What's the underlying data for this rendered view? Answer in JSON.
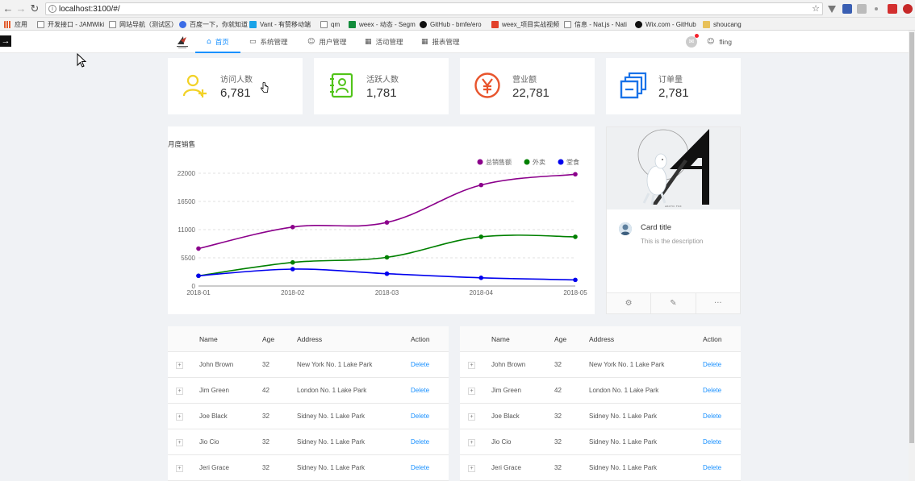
{
  "browser": {
    "url": "localhost:3100/#/",
    "bookmarks": [
      "应用",
      "开发接口 - JAMWiki",
      "网站导航（测试区）",
      "百度一下，你就知道",
      "Vant - 有赞移动端",
      "qm",
      "weex - 动态 - Segm",
      "GitHub - bmfe/ero",
      "weex_项目实战视频",
      "信息 - Nat.js - Nati",
      "Wix.com - GitHub",
      "shoucang"
    ]
  },
  "header": {
    "menu": [
      {
        "label": "首页",
        "icon": "home-icon",
        "active": true
      },
      {
        "label": "系统管理",
        "icon": "desktop-icon",
        "active": false
      },
      {
        "label": "用户管理",
        "icon": "user-icon",
        "active": false
      },
      {
        "label": "活动管理",
        "icon": "calendar-icon",
        "active": false
      },
      {
        "label": "报表管理",
        "icon": "table-icon",
        "active": false
      }
    ],
    "username": "fling"
  },
  "stats": [
    {
      "label": "访问人数",
      "value": "6,781",
      "icon": "user-add-icon",
      "color": "#f2d227"
    },
    {
      "label": "活跃人数",
      "value": "1,781",
      "icon": "contacts-icon",
      "color": "#52c41a"
    },
    {
      "label": "营业额",
      "value": "22,781",
      "icon": "yen-circle-icon",
      "color": "#e8542c"
    },
    {
      "label": "订单量",
      "value": "2,781",
      "icon": "orders-stack-icon",
      "color": "#1a73e8"
    }
  ],
  "chart_data": {
    "type": "line",
    "title": "月度销售",
    "categories": [
      "2018-01",
      "2018-02",
      "2018-03",
      "2018-04",
      "2018-05"
    ],
    "y_ticks": [
      "0",
      "5500",
      "11000",
      "16500",
      "22000"
    ],
    "ylim": [
      0,
      22000
    ],
    "legend_position": "top-right",
    "grid": true,
    "series": [
      {
        "name": "总销售额",
        "color": "#8b008b",
        "values": [
          7300,
          11500,
          12400,
          19700,
          21800
        ]
      },
      {
        "name": "外卖",
        "color": "#008000",
        "values": [
          2000,
          4600,
          5600,
          9600,
          9600
        ]
      },
      {
        "name": "堂食",
        "color": "#0000ee",
        "values": [
          2000,
          3300,
          2400,
          1600,
          1200
        ]
      }
    ]
  },
  "profile_card": {
    "title": "Card title",
    "description": "This is the description",
    "actions": [
      "setting-icon",
      "edit-icon",
      "ellipsis-icon"
    ],
    "cover_caption": "ARCTIC FOX"
  },
  "tables": [
    {
      "columns": [
        "Name",
        "Age",
        "Address",
        "Action"
      ],
      "rows": [
        {
          "name": "John Brown",
          "age": "32",
          "address": "New York No. 1 Lake Park",
          "action": "Delete"
        },
        {
          "name": "Jim Green",
          "age": "42",
          "address": "London No. 1 Lake Park",
          "action": "Delete"
        },
        {
          "name": "Joe Black",
          "age": "32",
          "address": "Sidney No. 1 Lake Park",
          "action": "Delete"
        },
        {
          "name": "Jio Cio",
          "age": "32",
          "address": "Sidney No. 1 Lake Park",
          "action": "Delete"
        },
        {
          "name": "Jeri Grace",
          "age": "32",
          "address": "Sidney No. 1 Lake Park",
          "action": "Delete"
        }
      ]
    },
    {
      "columns": [
        "Name",
        "Age",
        "Address",
        "Action"
      ],
      "rows": [
        {
          "name": "John Brown",
          "age": "32",
          "address": "New York No. 1 Lake Park",
          "action": "Delete"
        },
        {
          "name": "Jim Green",
          "age": "42",
          "address": "London No. 1 Lake Park",
          "action": "Delete"
        },
        {
          "name": "Joe Black",
          "age": "32",
          "address": "Sidney No. 1 Lake Park",
          "action": "Delete"
        },
        {
          "name": "Jio Cio",
          "age": "32",
          "address": "Sidney No. 1 Lake Park",
          "action": "Delete"
        },
        {
          "name": "Jeri Grace",
          "age": "32",
          "address": "Sidney No. 1 Lake Park",
          "action": "Delete"
        }
      ]
    }
  ]
}
